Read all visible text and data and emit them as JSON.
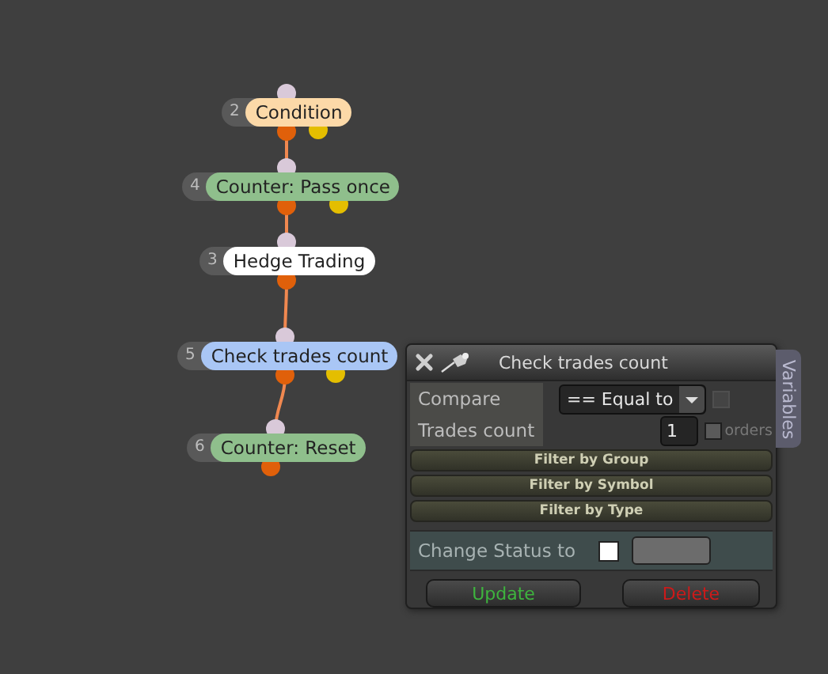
{
  "nodes": [
    {
      "number": "2",
      "label": "Condition",
      "color": "#fcd9a8",
      "side_output": true
    },
    {
      "number": "4",
      "label": "Counter: Pass once",
      "color": "#8fbf8c",
      "side_output": true
    },
    {
      "number": "3",
      "label": "Hedge Trading",
      "color": "#ffffff",
      "side_output": false
    },
    {
      "number": "5",
      "label": "Check trades count",
      "color": "#a9c6f5",
      "side_output": true
    },
    {
      "number": "6",
      "label": "Counter: Reset",
      "color": "#8fbf8c",
      "side_output": false
    }
  ],
  "panel": {
    "title": "Check trades count",
    "side_tab": "Variables",
    "compare": {
      "label": "Compare",
      "value": "== Equal to",
      "checkbox": {
        "checked": false,
        "disabled": true
      }
    },
    "trades_count": {
      "label": "Trades count",
      "value": "1",
      "unit_checkbox": {
        "checked": false,
        "label": "orders"
      }
    },
    "filters": [
      "Filter by Group",
      "Filter by Symbol",
      "Filter by Type"
    ],
    "change_status": {
      "label": "Change Status to",
      "checked": false
    },
    "buttons": [
      {
        "label": "Update",
        "kind": "update"
      },
      {
        "label": "Delete",
        "kind": "delete"
      }
    ]
  }
}
